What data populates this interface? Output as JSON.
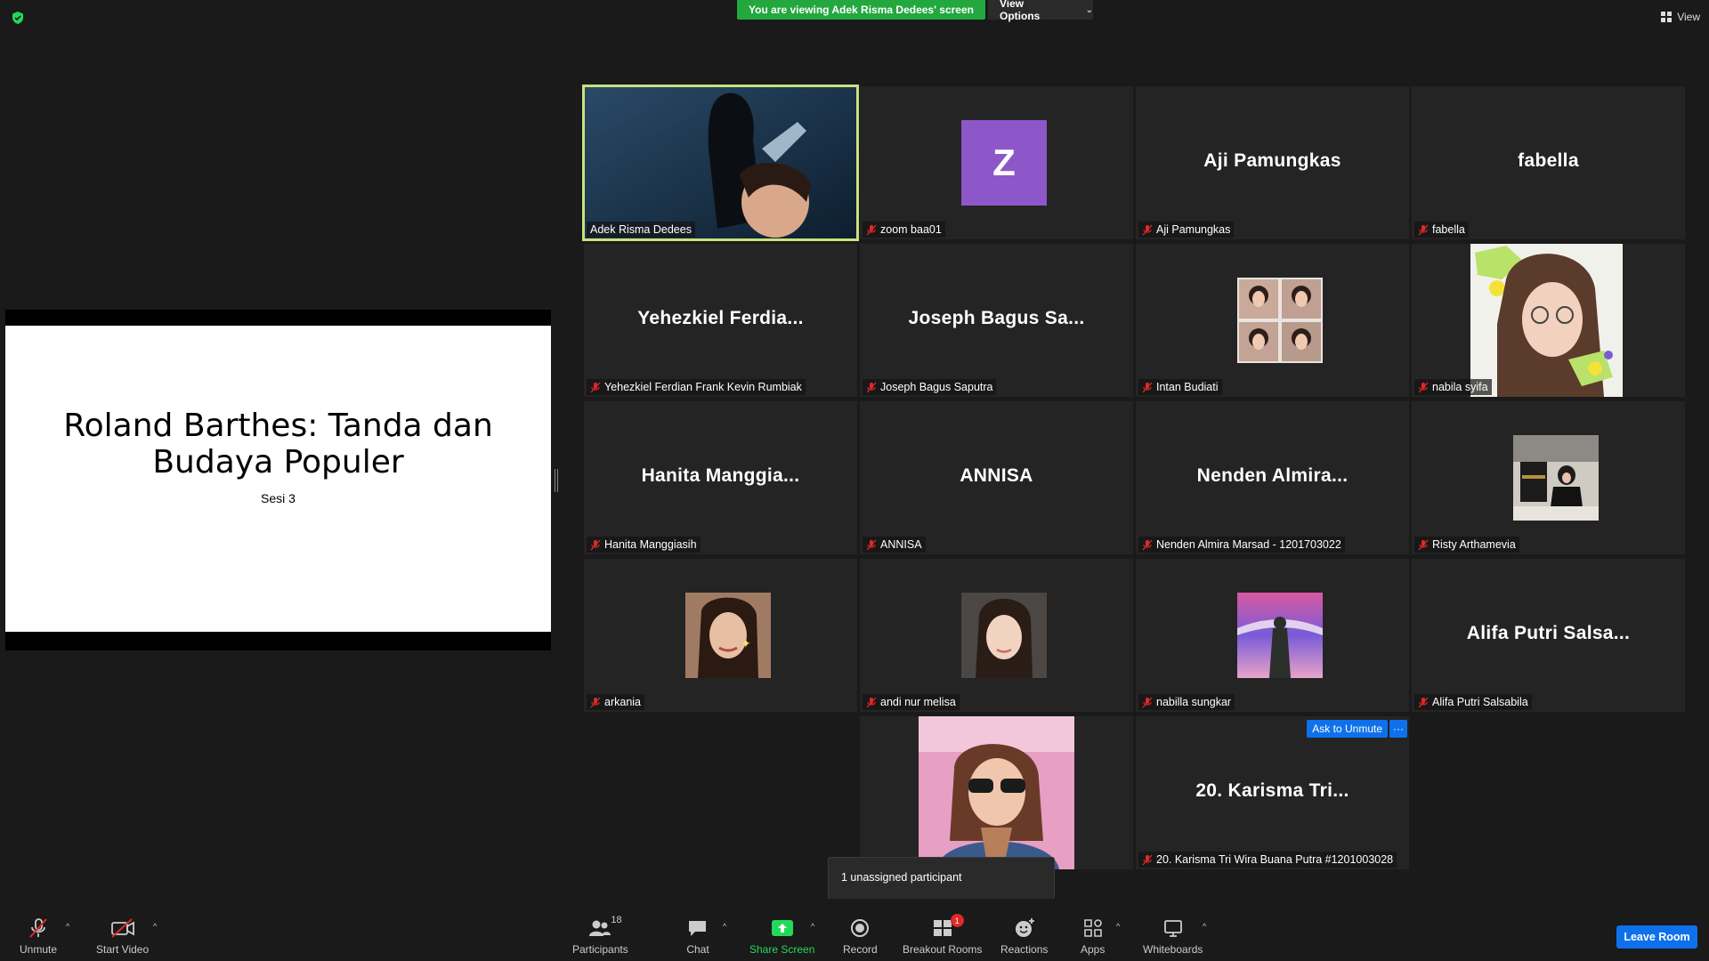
{
  "top_bar": {
    "viewing_banner": "You are viewing Adek Risma Dedees' screen",
    "view_options": "View Options",
    "view": "View"
  },
  "slide": {
    "title_line1": "Roland Barthes: Tanda dan",
    "title_line2": "Budaya Populer",
    "subtitle": "Sesi 3"
  },
  "tiles": [
    {
      "big": "",
      "label": "Adek Risma Dedees",
      "muted": false,
      "kind": "video-dark"
    },
    {
      "big": "",
      "label": "zoom baa01",
      "muted": true,
      "kind": "avatar",
      "avatar_letter": "Z",
      "avatar_color": "#8e57c9"
    },
    {
      "big": "Aji Pamungkas",
      "label": "Aji Pamungkas",
      "muted": true,
      "kind": "name"
    },
    {
      "big": "fabella",
      "label": "fabella",
      "muted": true,
      "kind": "name"
    },
    {
      "big": "Yehezkiel  Ferdia...",
      "label": "Yehezkiel Ferdian Frank Kevin Rumbiak",
      "muted": true,
      "kind": "name"
    },
    {
      "big": "Joseph Bagus Sa...",
      "label": "Joseph Bagus Saputra",
      "muted": true,
      "kind": "name"
    },
    {
      "big": "",
      "label": "Intan Budiati",
      "muted": true,
      "kind": "photo-grid"
    },
    {
      "big": "",
      "label": "nabila syifa",
      "muted": true,
      "kind": "photo-tall"
    },
    {
      "big": "Hanita  Manggia...",
      "label": "Hanita Manggiasih",
      "muted": true,
      "kind": "name"
    },
    {
      "big": "ANNISA",
      "label": "ANNISA",
      "muted": true,
      "kind": "name"
    },
    {
      "big": "Nenden  Almira...",
      "label": "Nenden Almira Marsad - 1201703022",
      "muted": true,
      "kind": "name"
    },
    {
      "big": "",
      "label": "Risty Arthamevia",
      "muted": true,
      "kind": "photo"
    },
    {
      "big": "",
      "label": "arkania",
      "muted": true,
      "kind": "photo"
    },
    {
      "big": "",
      "label": "andi nur melisa",
      "muted": true,
      "kind": "photo"
    },
    {
      "big": "",
      "label": "nabilla sungkar",
      "muted": true,
      "kind": "photo"
    },
    {
      "big": "Alifa  Putri  Salsa...",
      "label": "Alifa Putri Salsabila",
      "muted": true,
      "kind": "name"
    },
    {
      "big": "",
      "label": "",
      "muted": true,
      "kind": "photo-wide"
    },
    {
      "big": "20. Karisma Tri...",
      "label": "20. Karisma Tri Wira Buana Putra #1201003028",
      "muted": true,
      "kind": "name",
      "ask_unmute": "Ask to Unmute",
      "more": "···"
    }
  ],
  "tooltip": {
    "unassigned": "1 unassigned participant"
  },
  "toolbar": {
    "unmute": "Unmute",
    "start_video": "Start Video",
    "participants": "Participants",
    "participants_count": "18",
    "chat": "Chat",
    "share_screen": "Share Screen",
    "record": "Record",
    "breakout_rooms": "Breakout Rooms",
    "breakout_badge": "1",
    "reactions": "Reactions",
    "apps": "Apps",
    "whiteboards": "Whiteboards",
    "leave_room": "Leave Room"
  },
  "colors": {
    "active_speaker": "#c8e27b",
    "share_green": "#23a73f",
    "accent_blue": "#0e71eb",
    "muted_red": "#e02828"
  }
}
